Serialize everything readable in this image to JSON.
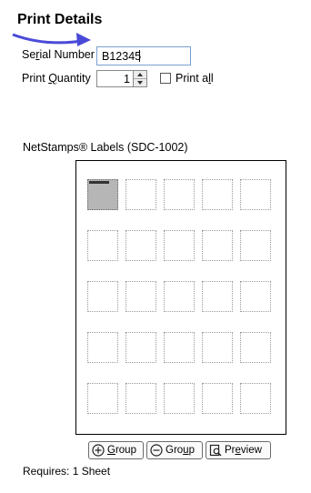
{
  "page": {
    "title": "Print Details"
  },
  "serial": {
    "label_pre": "Se",
    "label_ul": "r",
    "label_post": "ial Number",
    "value": "B12345"
  },
  "quantity": {
    "label_pre": "Print ",
    "label_ul": "Q",
    "label_post": "uantity",
    "value": "1"
  },
  "print_all": {
    "label_pre": "Print a",
    "label_ul": "l",
    "label_post": "l",
    "checked": false
  },
  "sheet": {
    "label": "NetStamps® Labels (SDC-1002)",
    "rows": 5,
    "cols": 5,
    "active_index": 0
  },
  "buttons": {
    "add_group": {
      "pre": "",
      "ul": "G",
      "post": "roup",
      "icon": "plus-circle-icon"
    },
    "remove_group": {
      "pre": "Gro",
      "ul": "u",
      "post": "p",
      "icon": "minus-circle-icon"
    },
    "preview": {
      "pre": "Pr",
      "ul": "e",
      "post": "view",
      "icon": "preview-icon"
    }
  },
  "requires": "Requires: 1 Sheet",
  "colors": {
    "arrow": "#4a4ad8",
    "input_border": "#7a9fd0",
    "active_stamp": "#b6b6b6"
  }
}
